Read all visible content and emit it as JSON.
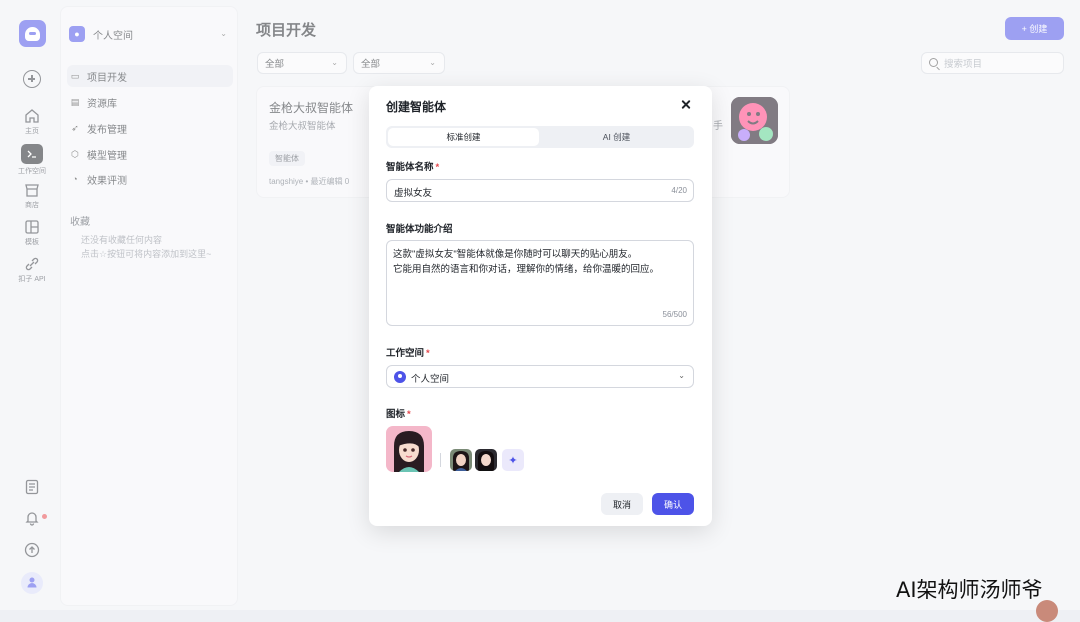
{
  "rail": {
    "items": [
      {
        "label": "主页",
        "icon": "home-icon"
      },
      {
        "label": "工作空间",
        "icon": "terminal-icon"
      },
      {
        "label": "商店",
        "icon": "store-icon"
      },
      {
        "label": "模板",
        "icon": "template-icon"
      },
      {
        "label": "扣子 API",
        "icon": "api-icon"
      }
    ]
  },
  "sidebar": {
    "workspace": "个人空间",
    "nav": [
      "项目开发",
      "资源库",
      "发布管理",
      "模型管理",
      "效果评测"
    ],
    "favorites_title": "收藏",
    "favorites_empty_1": "还没有收藏任何内容",
    "favorites_empty_2": "点击☆按钮可将内容添加到这里~"
  },
  "main": {
    "title": "项目开发",
    "create_button": "+ 创建",
    "filter1": "全部",
    "filter2": "全部",
    "search_placeholder": "搜索项目",
    "card": {
      "title": "金枪大叔智能体",
      "desc": "金枪大叔智能体",
      "tag": "智能体",
      "meta": "tangshiye • 最近编辑 0",
      "side_text": "手"
    }
  },
  "modal": {
    "title": "创建智能体",
    "tab_standard": "标准创建",
    "tab_ai": "AI 创建",
    "name_label": "智能体名称",
    "name_value": "虚拟女友",
    "name_count": "4/20",
    "desc_label": "智能体功能介绍",
    "desc_line1": "这款\"虚拟女友\"智能体就像是你随时可以聊天的贴心朋友。",
    "desc_line2": "它能用自然的语言和你对话，理解你的情绪，给你温暖的回应。",
    "desc_count": "56/500",
    "workspace_label": "工作空间",
    "workspace_value": "个人空间",
    "icon_label": "图标",
    "required_mark": "*",
    "cancel": "取消",
    "confirm": "确认"
  },
  "watermark": "AI架构师汤师爷",
  "colors": {
    "accent": "#4d53e8",
    "required": "#e5484d"
  }
}
